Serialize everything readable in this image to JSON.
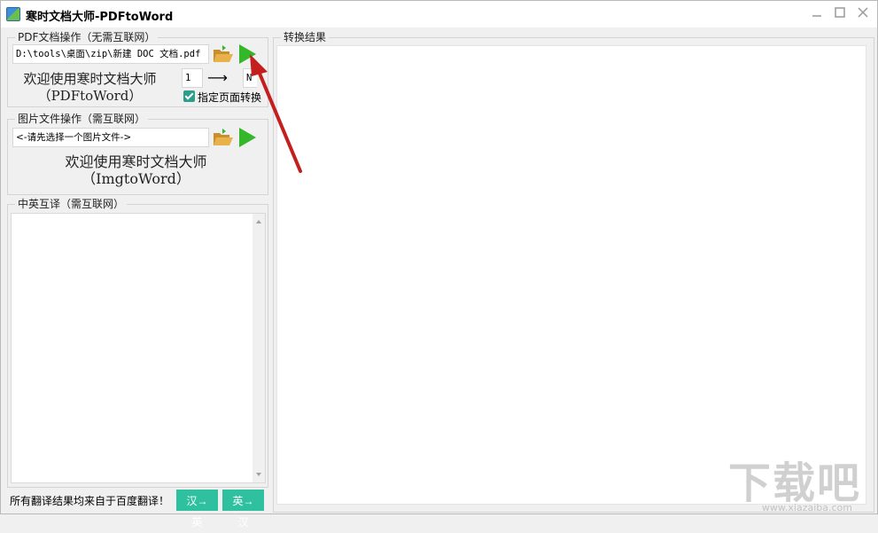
{
  "window": {
    "title": "寒时文档大师-PDFtoWord",
    "controls": [
      "minimize",
      "maximize",
      "close"
    ]
  },
  "pdf_section": {
    "legend": "PDF文档操作（无需互联网）",
    "file_path": "D:\\tools\\桌面\\zip\\新建 DOC 文档.pdf",
    "welcome_line1": "欢迎使用寒时文档大师",
    "welcome_line2": "（PDFtoWord）",
    "page_from": "1",
    "page_to": "N",
    "arrow": "⟶",
    "checkbox_label": "指定页面转换",
    "checkbox_checked": true
  },
  "image_section": {
    "legend": "图片文件操作（需互联网）",
    "file_placeholder": "<-请先选择一个图片文件->",
    "welcome_line1": "欢迎使用寒时文档大师",
    "welcome_line2": "（ImgtoWord）"
  },
  "translate_section": {
    "legend": "中英互译（需互联网）",
    "note": "所有翻译结果均来自于百度翻译！",
    "btn_cn_en": "汉→英",
    "btn_en_cn": "英→汉"
  },
  "result_section": {
    "legend": "转换结果"
  },
  "watermark": {
    "text": "下载吧",
    "sub": "www.xiazaiba.com"
  },
  "colors": {
    "accent_green": "#2fc0a0",
    "play_green": "#35b72a",
    "folder_yellow": "#e8b14a",
    "checkbox": "#2d9e8c"
  }
}
